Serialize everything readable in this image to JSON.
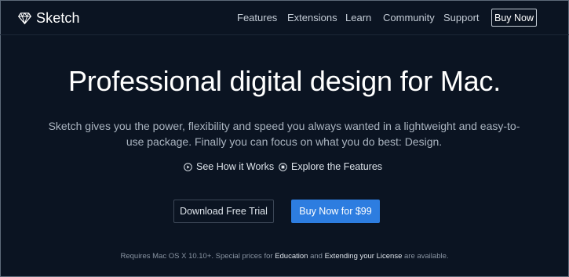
{
  "brand": {
    "name": "Sketch",
    "icon": "diamond-logo-icon"
  },
  "nav": {
    "items": [
      {
        "label": "Features"
      },
      {
        "label": "Extensions"
      },
      {
        "label": "Learn"
      },
      {
        "label": "Community"
      },
      {
        "label": "Support"
      }
    ],
    "buy_label": "Buy Now"
  },
  "hero": {
    "headline": "Professional digital design for Mac.",
    "lede": "Sketch gives you the power, flexibility and speed you always wanted in a lightweight and easy-to-use package. Finally you can focus on what you do best: Design.",
    "links": [
      {
        "label": "See How it Works",
        "icon": "play-circle-icon"
      },
      {
        "label": "Explore the Features",
        "icon": "square-circle-icon"
      }
    ],
    "trial_label": "Download Free Trial",
    "buy_label": "Buy Now for $99"
  },
  "footnote": {
    "prefix": "Requires Mac OS X 10.10+. Special prices for ",
    "link1": "Education",
    "middle": " and ",
    "link2": "Extending your License",
    "suffix": " are available."
  },
  "colors": {
    "background": "#0b1422",
    "accent": "#2d7de0",
    "muted_text": "#aab4c0"
  }
}
